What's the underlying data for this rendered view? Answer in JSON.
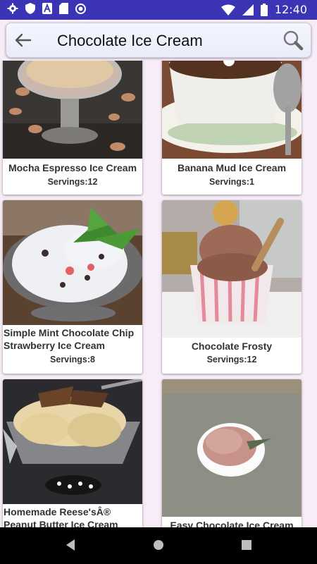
{
  "status": {
    "time": "12:40"
  },
  "search": {
    "title": "Chocolate Ice Cream"
  },
  "recipes": [
    {
      "title": "Mocha Espresso Ice Cream",
      "servings": "Servings:12"
    },
    {
      "title": "Banana Mud Ice Cream",
      "servings": "Servings:1"
    },
    {
      "title": "Simple Mint Chocolate Chip Strawberry Ice Cream",
      "servings": "Servings:8"
    },
    {
      "title": "Chocolate Frosty",
      "servings": "Servings:12"
    },
    {
      "title": "Homemade Reese'sÂ® Peanut Butter Ice Cream",
      "servings": ""
    },
    {
      "title": "Easy Chocolate Ice Cream",
      "servings": ""
    }
  ],
  "icons": {
    "back": "back-arrow-icon",
    "search": "magnifier-icon"
  }
}
